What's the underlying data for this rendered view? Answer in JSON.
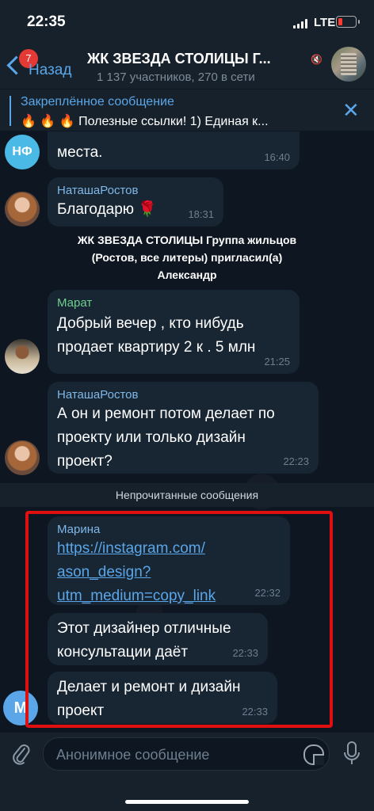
{
  "status": {
    "time": "22:35",
    "network": "LTE"
  },
  "header": {
    "back_label": "Назад",
    "unread_badge": "7",
    "title": "ЖК ЗВЕЗДА СТОЛИЦЫ Г...",
    "subtitle": "1 137 участников, 270 в сети"
  },
  "pinned": {
    "title": "Закреплённое сообщение",
    "emoji": "🔥 🔥 🔥",
    "text": "Полезные ссылки!  1) Единая к..."
  },
  "messages": {
    "m1": {
      "avatar": "НФ",
      "text": "места.",
      "time": "16:40"
    },
    "m2": {
      "sender": "НаташаРостов",
      "text": "Благодарю 🌹",
      "time": "18:31"
    },
    "service_1": "ЖК ЗВЕЗДА СТОЛИЦЫ Группа жильцов",
    "service_2": "(Ростов, все литеры) пригласил(а)",
    "service_3": "Александр",
    "m3": {
      "sender": "Марат",
      "line1": "Добрый вечер , кто нибудь",
      "line2": "продает квартиру 2 к . 5 млн",
      "time": "21:25"
    },
    "m4": {
      "sender": "НаташаРостов",
      "line1": "А он и ремонт потом делает по",
      "line2": "проекту или только дизайн",
      "line3": "проект?",
      "time": "22:23"
    },
    "unread_divider": "Непрочитанные сообщения",
    "m5": {
      "sender": "Марина",
      "link1": "https://instagram.com/",
      "link2": "ason_design?",
      "link3": "utm_medium=copy_link",
      "time": "22:32"
    },
    "m6": {
      "line1": "Этот дизайнер отличные",
      "line2": "консультации даёт",
      "time": "22:33"
    },
    "m7": {
      "avatar": "М",
      "line1": "Делает и ремонт и дизайн",
      "line2": "проект",
      "time": "22:33"
    }
  },
  "input": {
    "placeholder": "Анонимное сообщение"
  },
  "colors": {
    "accent": "#5aa6e8",
    "highlight_box": "#e01010",
    "marat_name": "#6fcf8f",
    "natasha_name": "#7fb8e8"
  }
}
